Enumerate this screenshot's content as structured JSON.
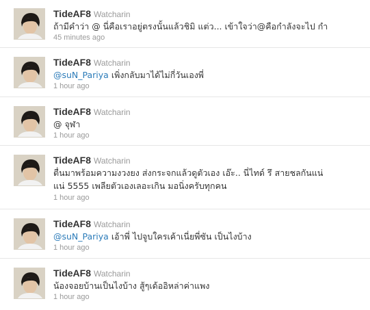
{
  "tweets": [
    {
      "screen_name": "TideAF8",
      "full_name": "Watcharin",
      "mention": "",
      "lines": [
        "ถ้ามีคำว่า @ นี่คือเราอยู่ตรงนั้นแล้วชิมิ แต่ว... เข้าใจว่า@คือกำลังจะไป กำ"
      ],
      "time": "45 minutes ago"
    },
    {
      "screen_name": "TideAF8",
      "full_name": "Watcharin",
      "mention": "@suN_Pariya",
      "lines": [
        " เพิ่งกลับมาได้ไม่กี่วันเองพี่"
      ],
      "time": "1 hour ago"
    },
    {
      "screen_name": "TideAF8",
      "full_name": "Watcharin",
      "mention": "",
      "lines": [
        "@ จุฬา"
      ],
      "time": "1 hour ago"
    },
    {
      "screen_name": "TideAF8",
      "full_name": "Watcharin",
      "mention": "",
      "lines": [
        "ตื่นมาพร้อมความงวงยง ส่งกระจกแล้วดูตัวเอง เอ๊ะ.. นี่ไทด์ รึ สายชลกันแน่",
        "แน่ 5555 เพลียตัวเองเลอะเกิน มอนิ่งครับทุกคน"
      ],
      "time": "1 hour ago"
    },
    {
      "screen_name": "TideAF8",
      "full_name": "Watcharin",
      "mention": "@suN_Pariya",
      "lines": [
        " เอ้าพี่ ไปจูบใครเค้าเนี่ยพี่ซัน เป็นไงบ้าง"
      ],
      "time": "1 hour ago"
    },
    {
      "screen_name": "TideAF8",
      "full_name": "Watcharin",
      "mention": "",
      "lines": [
        "น้องจอยบ้านเป็นไงบ้าง สู้ๆเด้ออิหล่าค่าแพง"
      ],
      "time": "1 hour ago"
    }
  ]
}
